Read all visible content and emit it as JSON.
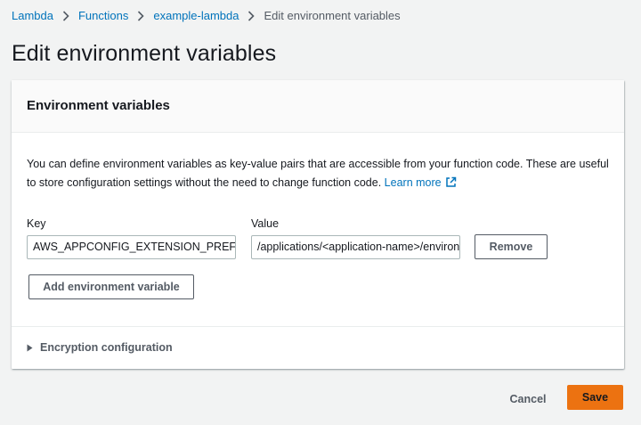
{
  "breadcrumb": {
    "items": [
      "Lambda",
      "Functions",
      "example-lambda"
    ],
    "current": "Edit environment variables"
  },
  "page_title": "Edit environment variables",
  "panel": {
    "title": "Environment variables",
    "description": "You can define environment variables as key-value pairs that are accessible from your function code. These are useful to store configuration settings without the need to change function code.",
    "learn_more": "Learn more",
    "key_label": "Key",
    "value_label": "Value",
    "variable": {
      "key": "AWS_APPCONFIG_EXTENSION_PREFETCH_LIST",
      "value": "/applications/<application-name>/environments/<environment-name>/configurations/<configuration-name>"
    },
    "remove_label": "Remove",
    "add_label": "Add environment variable",
    "encryption_label": "Encryption configuration"
  },
  "footer": {
    "cancel_label": "Cancel",
    "save_label": "Save"
  },
  "colors": {
    "link": "#0073bb",
    "primary": "#ec7211",
    "background": "#f2f3f3"
  }
}
